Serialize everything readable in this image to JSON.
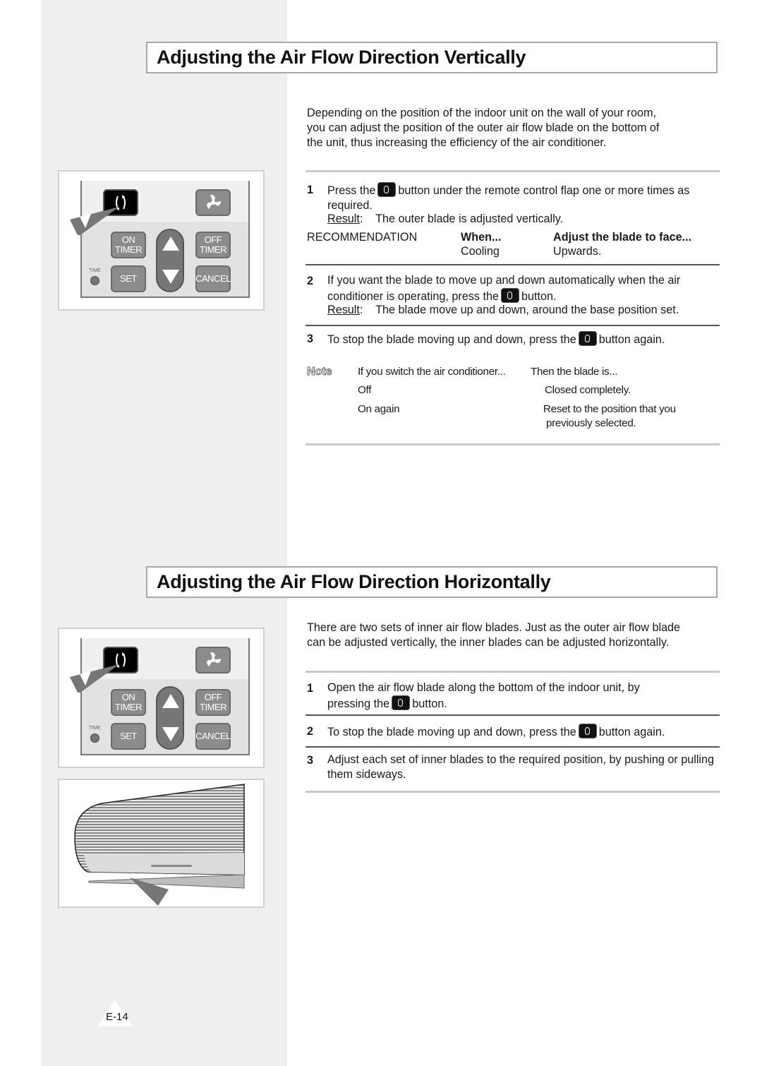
{
  "section1": {
    "title": "Adjusting the Air Flow Direction Vertically",
    "intro": "Depending on the position of the indoor unit on the wall of your room, you can adjust the position of the outer air flow blade on the bottom of the unit, thus increasing the efficiency of the air conditioner.",
    "steps": [
      {
        "num": "1",
        "text_before": "Press the",
        "text_after": "button under the remote control flap one or more times as required.",
        "result_label": "Result",
        "result_text": "The outer blade is adjusted vertically."
      },
      {
        "num": "2",
        "text_line1": "If you want the blade to move up and down automatically when the air",
        "text_before": "conditioner is operating, press the",
        "text_after": "button.",
        "result_label": "Result",
        "result_text": "The blade move up and down, around the base position set."
      },
      {
        "num": "3",
        "text_before": "To stop the blade moving up and down, press the",
        "text_after": "button again."
      }
    ],
    "recommendation": {
      "label": "RECOMMENDATION",
      "col1_header": "When...",
      "col2_header": "Adjust the blade to face...",
      "col1_value": "Cooling",
      "col2_value": "Upwards."
    },
    "note": {
      "label": "Note",
      "col1_header": "If you switch the air conditioner...",
      "col2_header": "Then the blade is...",
      "rows": [
        {
          "when": "Off",
          "then": "Closed completely."
        },
        {
          "when": "On again",
          "then": "Reset to the position that you",
          "then2": "previously selected."
        }
      ]
    }
  },
  "section2": {
    "title": "Adjusting the Air Flow Direction Horizontally",
    "intro": "There are two sets of inner air flow blades. Just as the outer air flow blade can be adjusted vertically, the inner blades can be adjusted horizontally.",
    "steps": [
      {
        "num": "1",
        "text_line1": "Open the air flow blade along the bottom of the indoor unit, by",
        "text_before": "pressing the",
        "text_after": "button."
      },
      {
        "num": "2",
        "text_before": "To stop the blade moving up and down, press the",
        "text_after": "button again."
      },
      {
        "num": "3",
        "text": "Adjust each set of inner blades to the required position, by pushing or pulling them sideways."
      }
    ]
  },
  "remote": {
    "on_timer": [
      "ON",
      "TIMER"
    ],
    "off_timer": [
      "OFF",
      "TIMER"
    ],
    "set": "SET",
    "cancel": "CANCEL",
    "time": "TIME"
  },
  "footer": {
    "page_number": "E-14"
  }
}
